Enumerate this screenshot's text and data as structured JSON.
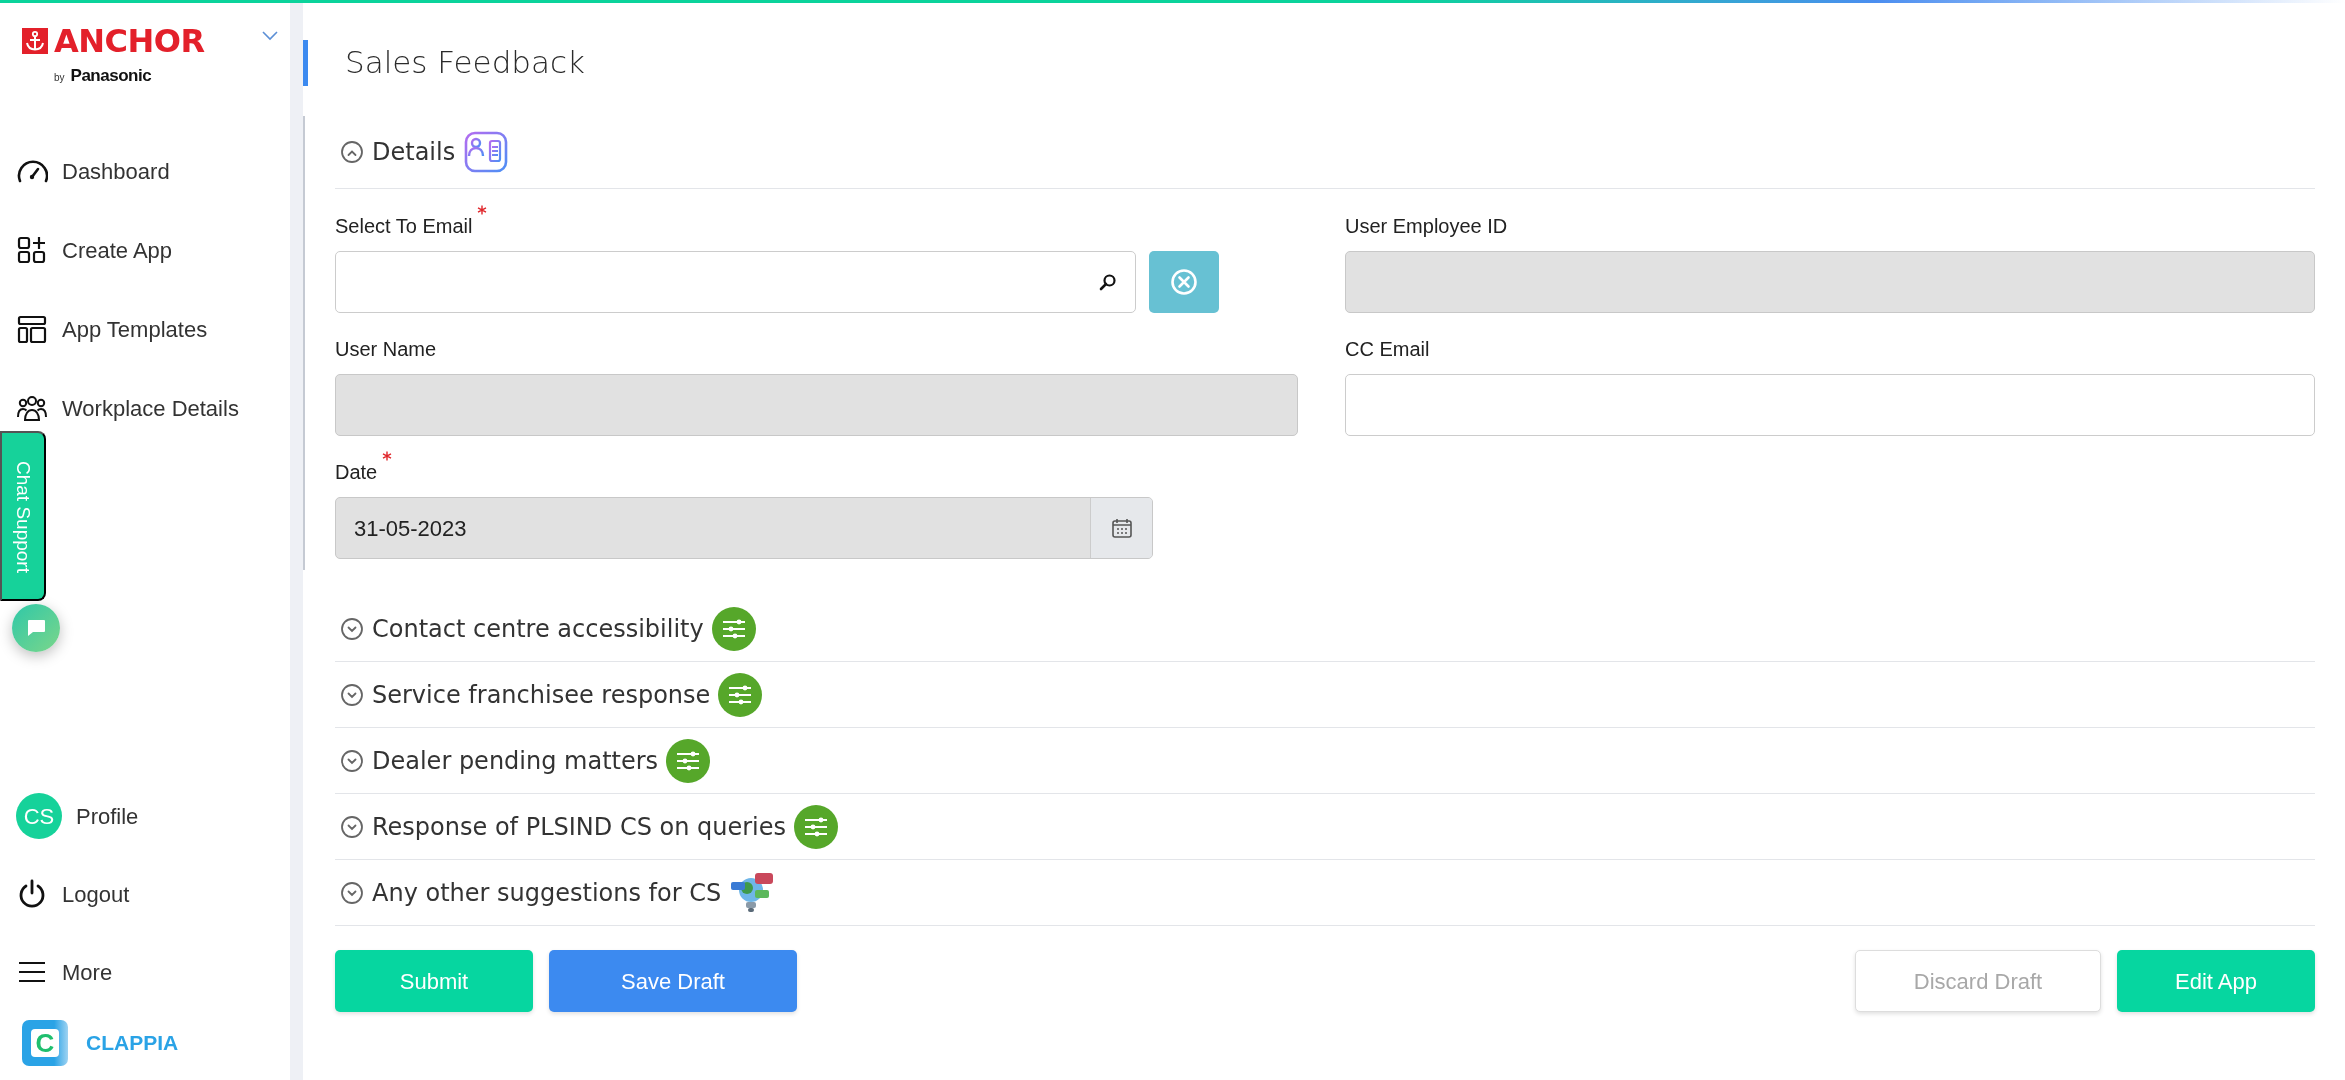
{
  "sidebar": {
    "brand": {
      "name": "ANCHOR",
      "by": "by",
      "maker": "Panasonic"
    },
    "nav": [
      {
        "label": "Dashboard"
      },
      {
        "label": "Create App"
      },
      {
        "label": "App Templates"
      },
      {
        "label": "Workplace Details"
      }
    ],
    "chat_support": {
      "label": "Chat Support"
    },
    "bottom": [
      {
        "kind": "avatar",
        "initials": "CS",
        "label": "Profile"
      },
      {
        "kind": "power",
        "label": "Logout"
      },
      {
        "kind": "menu",
        "label": "More"
      }
    ],
    "footer_logo": {
      "letter": "C",
      "name": "CLAPPIA"
    }
  },
  "title": "Sales Feedback",
  "sections": [
    {
      "title": "Details",
      "expanded": true,
      "kind": "contact-card",
      "fields": [
        {
          "label": "Select To Email",
          "required": true,
          "kind": "search",
          "disabled": false
        },
        {
          "label": "User Employee ID",
          "required": false,
          "kind": "text",
          "disabled": true
        },
        {
          "label": "User Name",
          "required": false,
          "kind": "text",
          "disabled": true
        },
        {
          "label": "CC Email",
          "required": false,
          "kind": "text",
          "disabled": false
        },
        {
          "label": "Date",
          "required": true,
          "kind": "date",
          "disabled": true,
          "value": "31-05-2023"
        }
      ]
    },
    {
      "title": "Contact centre accessibility",
      "expanded": false,
      "kind": "sliders"
    },
    {
      "title": "Service franchisee response",
      "expanded": false,
      "kind": "sliders"
    },
    {
      "title": "Dealer pending matters",
      "expanded": false,
      "kind": "sliders"
    },
    {
      "title": "Response of PLSIND CS on queries",
      "expanded": false,
      "kind": "sliders"
    },
    {
      "title": "Any other suggestions for CS",
      "expanded": false,
      "kind": "lightbulb"
    }
  ],
  "buttons": [
    {
      "label": "Submit",
      "kind": "success",
      "disabled": false
    },
    {
      "label": "Save Draft",
      "kind": "primary",
      "disabled": false
    },
    {
      "label": "Discard Draft",
      "kind": "outline",
      "disabled": true
    },
    {
      "label": "Edit App",
      "kind": "success",
      "disabled": false
    }
  ]
}
